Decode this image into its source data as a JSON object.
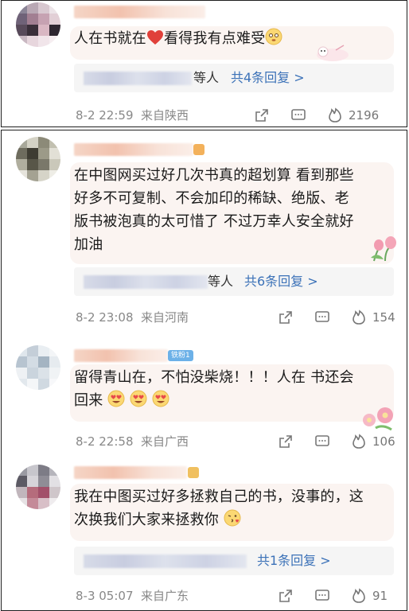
{
  "comments": [
    {
      "text": "人在书就在❤看得我有点难受😳",
      "text_before_heart": "人在书就在",
      "text_after_heart": "看得我有点难受",
      "replies_who": "等人",
      "replies_link": "共4条回复 >",
      "time": "8-2 22:59",
      "location": "来自陕西",
      "likes": "2196"
    },
    {
      "text_lines": [
        "在中图网买过好几次书真的超划算 看到那些",
        "好多不可复制、不会加印的稀缺、绝版、老",
        "版书被泡真的太可惜了 不过万幸人安全就好",
        "加油"
      ],
      "replies_who": "等人",
      "replies_link": "共6条回复 >",
      "time": "8-2 23:08",
      "location": "来自河南",
      "likes": "154"
    },
    {
      "badge": "铁粉1",
      "text_lines": [
        "留得青山在，不怕没柴烧！！！人在 书还会",
        "回来"
      ],
      "time": "8-2 22:58",
      "location": "来自广西",
      "likes": "106"
    },
    {
      "text_lines": [
        "我在中图买过好多拯救自己的书，没事的，这",
        "次换我们大家来拯救你"
      ],
      "replies_link": "共1条回复 >",
      "time": "8-3 05:07",
      "location": "来自广东",
      "likes": "91"
    }
  ],
  "icons": {
    "share": "share-icon",
    "comment": "comment-icon",
    "like": "like-flame-icon"
  },
  "colors": {
    "link": "#3c72b8",
    "heart": "#e0403a",
    "badge": "#6cb1e8"
  }
}
